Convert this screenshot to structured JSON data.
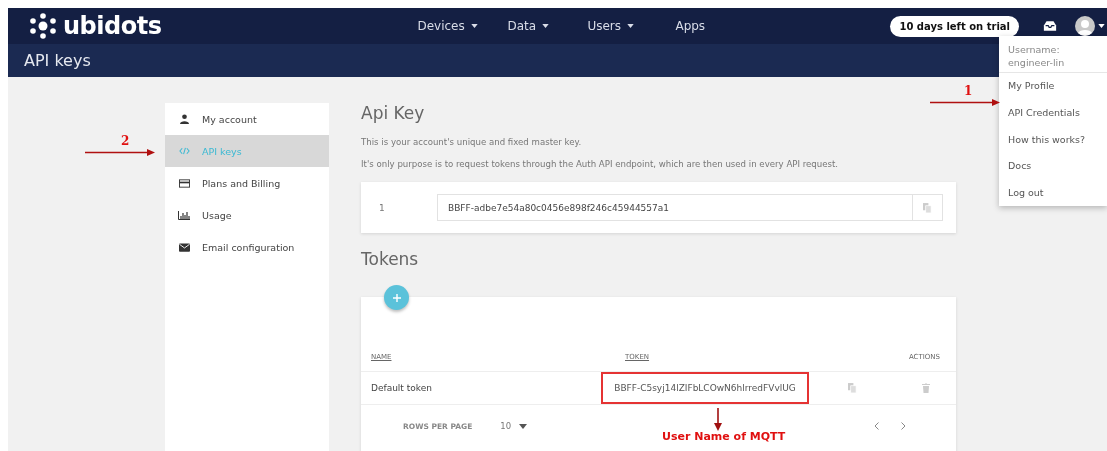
{
  "navbar": {
    "logo": "ubidots",
    "menu": [
      {
        "label": "Devices",
        "dropdown": true
      },
      {
        "label": "Data",
        "dropdown": true
      },
      {
        "label": "Users",
        "dropdown": true
      },
      {
        "label": "Apps",
        "dropdown": false
      }
    ],
    "trial_badge": "10 days left on trial"
  },
  "page_header": {
    "title": "API keys"
  },
  "sidebar": {
    "items": [
      {
        "label": "My account",
        "selected": false
      },
      {
        "label": "API keys",
        "selected": true
      },
      {
        "label": "Plans and Billing",
        "selected": false
      },
      {
        "label": "Usage",
        "selected": false
      },
      {
        "label": "Email configuration",
        "selected": false
      }
    ]
  },
  "api_key": {
    "title": "Api Key",
    "description": [
      "This is your account's unique and fixed master key.",
      "It's only purpose is to request tokens through the Auth API endpoint, which are then used in every API request."
    ],
    "keys": [
      {
        "number": "1",
        "value": "BBFF-adbe7e54a80c0456e898f246c45944557a1"
      }
    ]
  },
  "tokens": {
    "title": "Tokens",
    "columns": [
      "NAME",
      "TOKEN",
      "ACTIONS"
    ],
    "rows": [
      {
        "name": "Default token",
        "token": "BBFF-C5syj14lZIFbLCOwN6hlrredFVvlUG",
        "highlighted": true
      }
    ],
    "rows_per_page_label": "ROWS PER PAGE",
    "rows_per_page": "10"
  },
  "user_menu": {
    "username_label": "Username:",
    "username": "engineer-lin",
    "items": [
      "My Profile",
      "API Credentials",
      "How this works?",
      "Docs",
      "Log out"
    ]
  },
  "annotations": [
    {
      "kind": "arrow",
      "label": "1"
    },
    {
      "kind": "arrow",
      "label": "2"
    },
    {
      "kind": "caption",
      "label": "User Name of MQTT"
    }
  ]
}
